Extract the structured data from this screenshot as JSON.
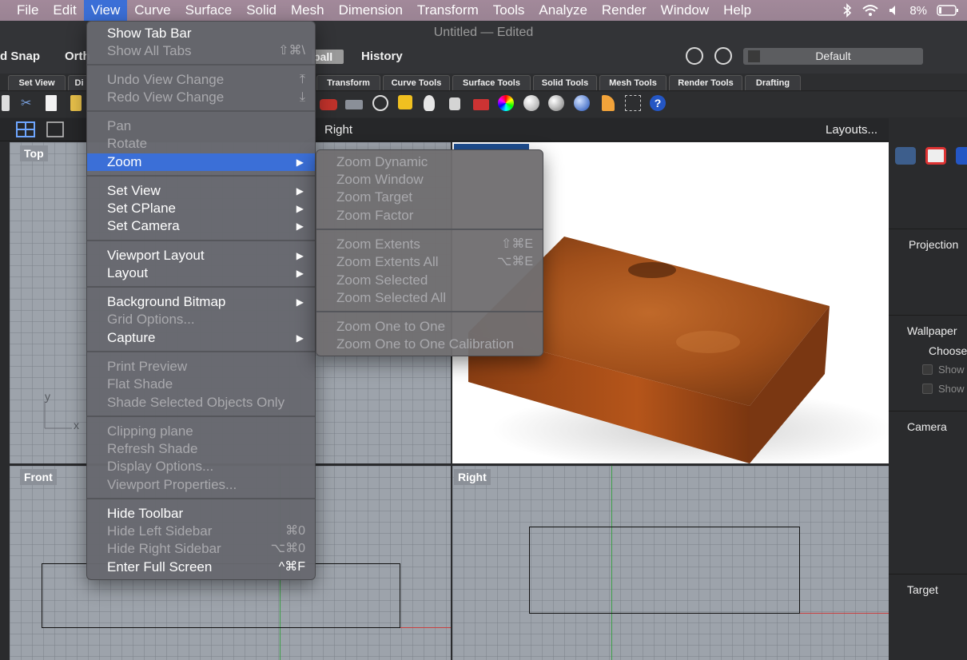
{
  "menubar": {
    "items": [
      "File",
      "Edit",
      "View",
      "Curve",
      "Surface",
      "Solid",
      "Mesh",
      "Dimension",
      "Transform",
      "Tools",
      "Analyze",
      "Render",
      "Window",
      "Help"
    ],
    "battery": "8%"
  },
  "window": {
    "title": "Untitled — Edited"
  },
  "command_bar": {
    "snap": "d Snap",
    "ortho": "Orth",
    "gumball": "ball",
    "history": "History",
    "layer": "Default"
  },
  "toolbar_tabs": [
    "Set View",
    "Di",
    "Transform",
    "Curve Tools",
    "Surface Tools",
    "Solid Tools",
    "Mesh Tools",
    "Render Tools",
    "Drafting"
  ],
  "viewbar": {
    "active_view": "Right",
    "layouts": "Layouts..."
  },
  "viewports": {
    "top": {
      "label": "Top",
      "y_axis": "y",
      "x_axis": "x"
    },
    "front": {
      "label": "Front"
    },
    "right": {
      "label": "Right"
    }
  },
  "right_panel": {
    "projection": "Projection",
    "wallpaper": "Wallpaper",
    "choose": "Choose",
    "show1": "Show",
    "show2": "Show",
    "camera": "Camera",
    "target": "Target"
  },
  "view_menu": {
    "items": [
      {
        "label": "Show Tab Bar",
        "shortcut": "",
        "enabled": true,
        "submenu": false
      },
      {
        "label": "Show All Tabs",
        "shortcut": "⇧⌘\\",
        "enabled": false,
        "submenu": false
      },
      {
        "label": "Undo View Change",
        "shortcut": "⤒",
        "enabled": false,
        "submenu": false
      },
      {
        "label": "Redo View Change",
        "shortcut": "⤓",
        "enabled": false,
        "submenu": false
      },
      {
        "label": "Pan",
        "shortcut": "",
        "enabled": false,
        "submenu": false
      },
      {
        "label": "Rotate",
        "shortcut": "",
        "enabled": false,
        "submenu": false
      },
      {
        "label": "Zoom",
        "shortcut": "",
        "enabled": true,
        "submenu": true,
        "highlighted": true
      },
      {
        "label": "Set View",
        "shortcut": "",
        "enabled": true,
        "submenu": true
      },
      {
        "label": "Set CPlane",
        "shortcut": "",
        "enabled": true,
        "submenu": true
      },
      {
        "label": "Set Camera",
        "shortcut": "",
        "enabled": true,
        "submenu": true
      },
      {
        "label": "Viewport Layout",
        "shortcut": "",
        "enabled": true,
        "submenu": true
      },
      {
        "label": "Layout",
        "shortcut": "",
        "enabled": true,
        "submenu": true
      },
      {
        "label": "Background Bitmap",
        "shortcut": "",
        "enabled": true,
        "submenu": true
      },
      {
        "label": "Grid Options...",
        "shortcut": "",
        "enabled": false,
        "submenu": false
      },
      {
        "label": "Capture",
        "shortcut": "",
        "enabled": true,
        "submenu": true
      },
      {
        "label": "Print Preview",
        "shortcut": "",
        "enabled": false,
        "submenu": false
      },
      {
        "label": "Flat Shade",
        "shortcut": "",
        "enabled": false,
        "submenu": false
      },
      {
        "label": "Shade Selected Objects Only",
        "shortcut": "",
        "enabled": false,
        "submenu": false
      },
      {
        "label": "Clipping plane",
        "shortcut": "",
        "enabled": false,
        "submenu": false
      },
      {
        "label": "Refresh Shade",
        "shortcut": "",
        "enabled": false,
        "submenu": false
      },
      {
        "label": "Display Options...",
        "shortcut": "",
        "enabled": false,
        "submenu": false
      },
      {
        "label": "Viewport Properties...",
        "shortcut": "",
        "enabled": false,
        "submenu": false
      },
      {
        "label": "Hide Toolbar",
        "shortcut": "",
        "enabled": true,
        "submenu": false
      },
      {
        "label": "Hide Left Sidebar",
        "shortcut": "⌘0",
        "enabled": false,
        "submenu": false
      },
      {
        "label": "Hide Right Sidebar",
        "shortcut": "⌥⌘0",
        "enabled": false,
        "submenu": false
      },
      {
        "label": "Enter Full Screen",
        "shortcut": "^⌘F",
        "enabled": true,
        "submenu": false
      }
    ]
  },
  "zoom_submenu": {
    "items": [
      {
        "label": "Zoom Dynamic",
        "shortcut": ""
      },
      {
        "label": "Zoom Window",
        "shortcut": ""
      },
      {
        "label": "Zoom Target",
        "shortcut": ""
      },
      {
        "label": "Zoom Factor",
        "shortcut": ""
      },
      {
        "label": "Zoom Extents",
        "shortcut": "⇧⌘E"
      },
      {
        "label": "Zoom Extents All",
        "shortcut": "⌥⌘E"
      },
      {
        "label": "Zoom Selected",
        "shortcut": ""
      },
      {
        "label": "Zoom Selected All",
        "shortcut": ""
      },
      {
        "label": "Zoom One to One",
        "shortcut": ""
      },
      {
        "label": "Zoom One to One Calibration",
        "shortcut": ""
      }
    ]
  },
  "colors": {
    "accent": "#3b6fd7",
    "menubar": "#9e8797",
    "wood": "#a8501c"
  }
}
